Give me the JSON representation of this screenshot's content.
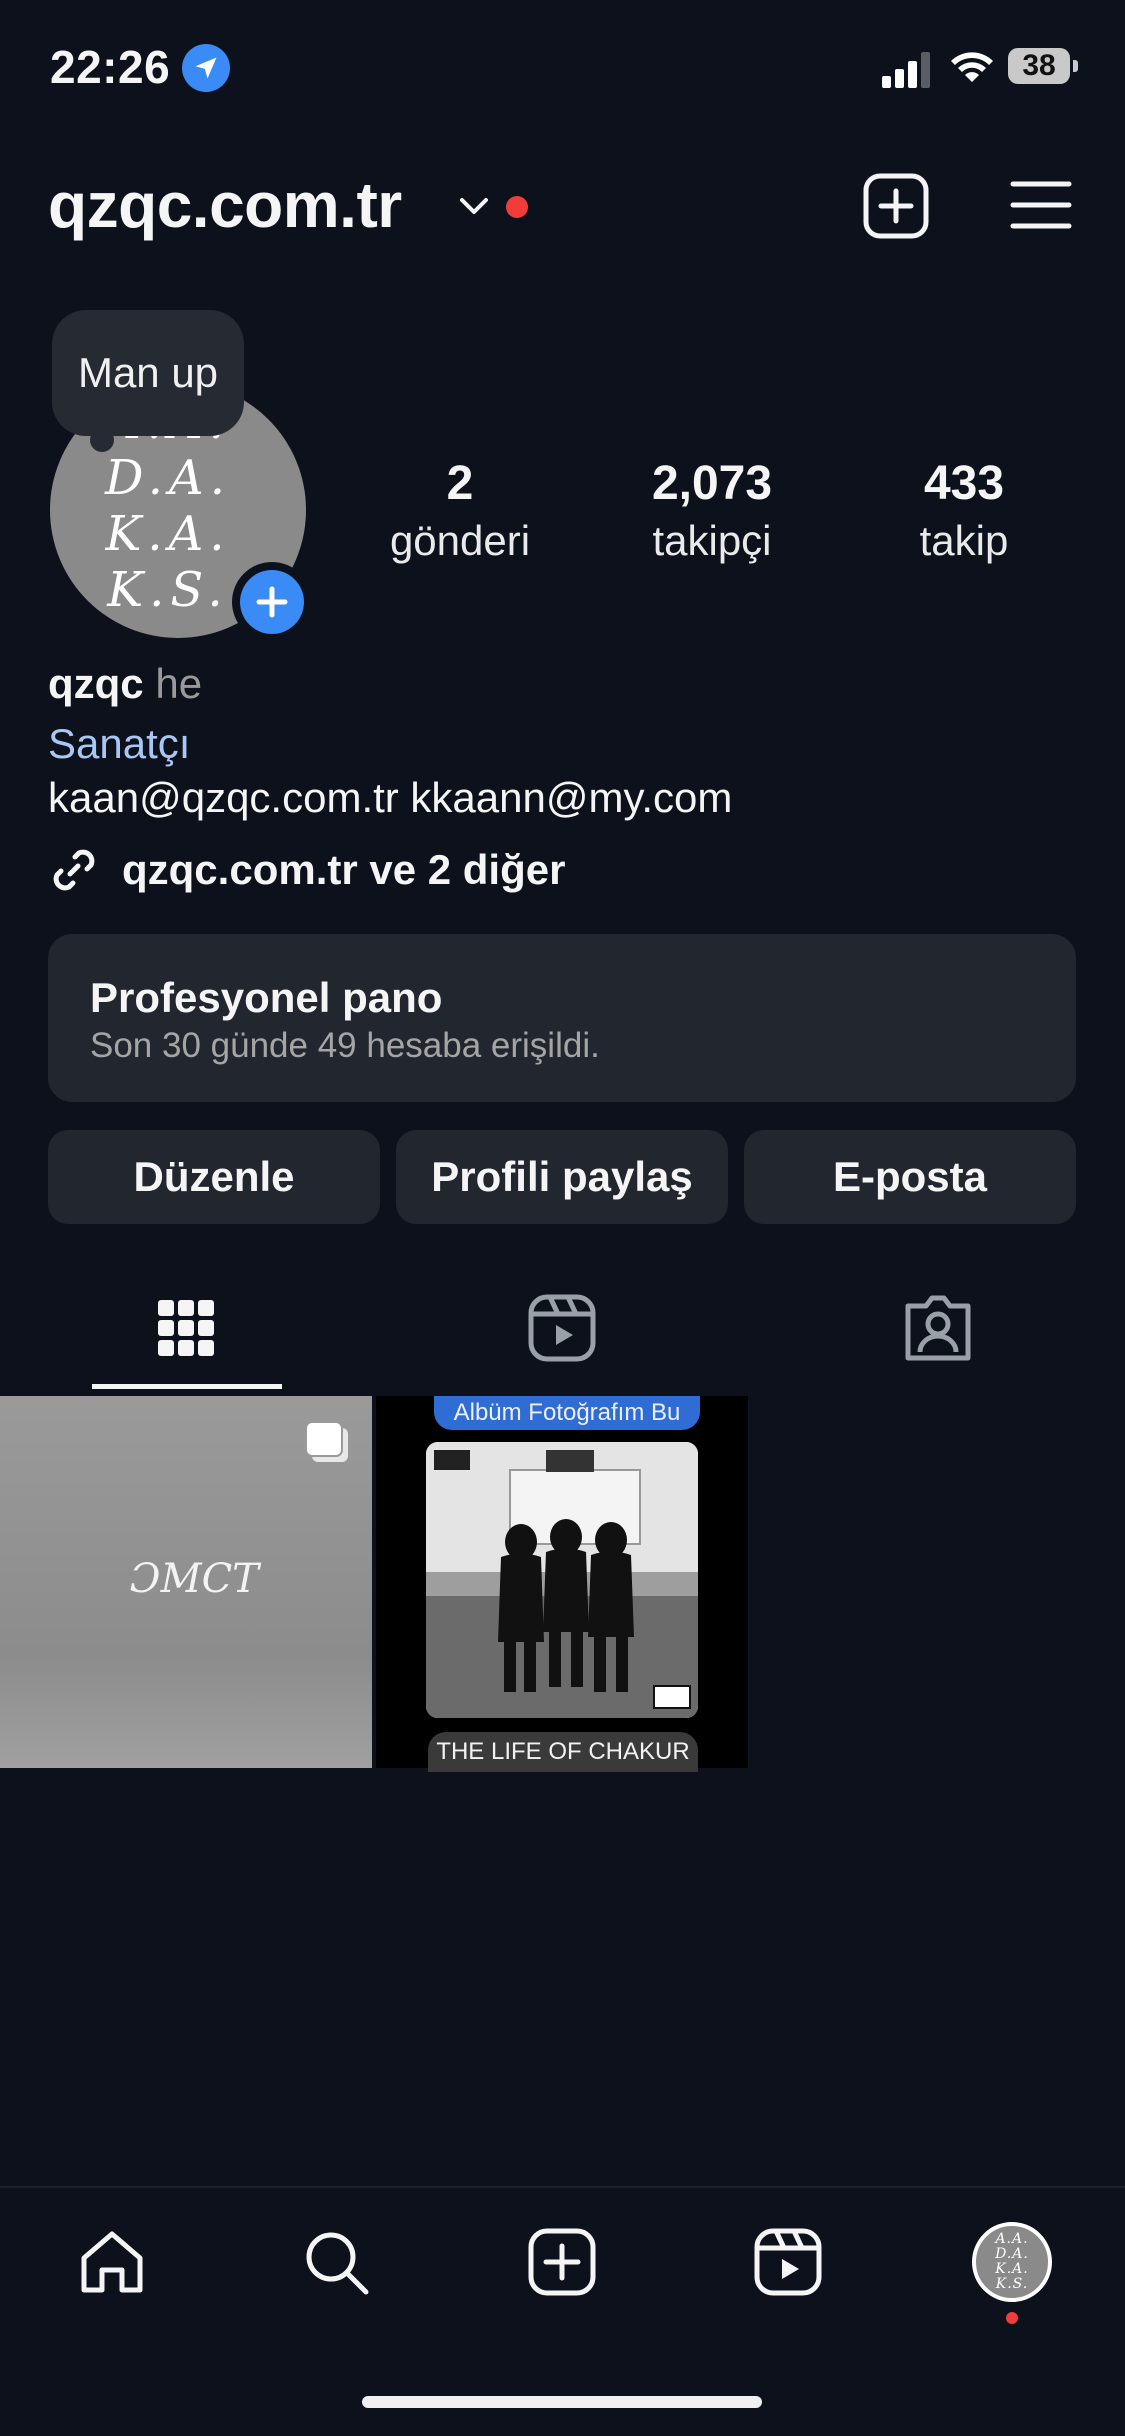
{
  "status_bar": {
    "time": "22:26",
    "battery": "38"
  },
  "header": {
    "username": "qzqc.com.tr"
  },
  "profile": {
    "note": "Man up",
    "avatar_text": "A.A.\nD.A.\nK.A.\nK.S.",
    "stats": [
      {
        "value": "2",
        "label": "gönderi"
      },
      {
        "value": "2,073",
        "label": "takipçi"
      },
      {
        "value": "433",
        "label": "takip"
      }
    ],
    "name": "qzqc",
    "pronoun": "he",
    "category": "Sanatçı",
    "bio": "kaan@qzqc.com.tr kkaann@my.com",
    "link": "qzqc.com.tr ve 2 diğer"
  },
  "pro_panel": {
    "title": "Profesyonel pano",
    "subtitle": "Son 30 günde 49 hesaba erişildi."
  },
  "buttons": {
    "edit": "Düzenle",
    "share": "Profili paylaş",
    "email": "E-posta"
  },
  "posts": [
    {
      "signature": "ƆMCT"
    },
    {
      "top_label": "Albüm Fotoğrafım Bu",
      "bottom_label": "THE LIFE OF CHAKUR"
    }
  ],
  "colors": {
    "background": "#0c111b",
    "accent": "#3a8bf5",
    "notification": "#f23b3b",
    "surface": "#22262f"
  }
}
